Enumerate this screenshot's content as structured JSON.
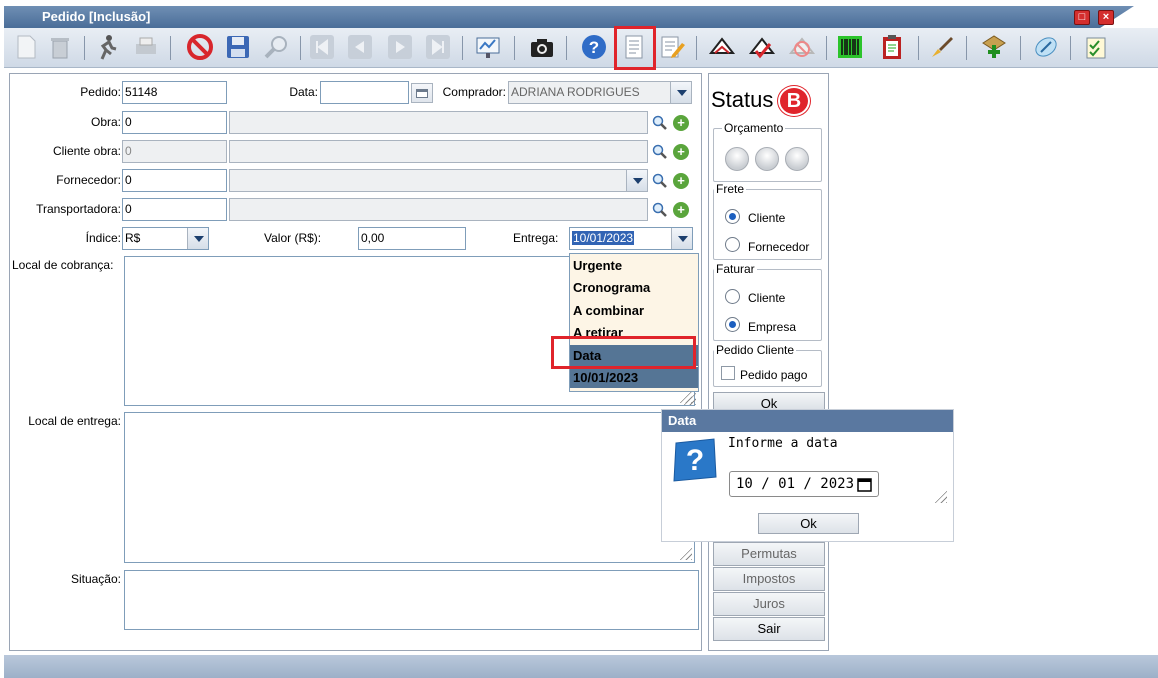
{
  "window": {
    "title": "Pedido [Inclusão]"
  },
  "toolbar": {
    "icons": [
      "new-icon",
      "trash-icon",
      "runner-icon",
      "print-icon",
      "stop-icon",
      "save-icon",
      "search-icon",
      "first-icon",
      "prev-icon",
      "next-icon",
      "last-icon",
      "report-icon",
      "camera-icon",
      "help-icon",
      "document-icon",
      "edit-icon",
      "hat-icon",
      "hat-check-icon",
      "hat-cancel-icon",
      "barcode-icon",
      "clipboard-icon",
      "brush-icon",
      "arrow-add-icon",
      "phone-icon",
      "checklist-icon"
    ]
  },
  "form": {
    "pedido_label": "Pedido:",
    "pedido_value": "51148",
    "data_label": "Data:",
    "data_value": "",
    "comprador_label": "Comprador:",
    "comprador_value": "ADRIANA RODRIGUES",
    "obra_label": "Obra:",
    "obra_value": "0",
    "cliente_obra_label": "Cliente obra:",
    "cliente_obra_value": "0",
    "fornecedor_label": "Fornecedor:",
    "fornecedor_value": "0",
    "transportadora_label": "Transportadora:",
    "transportadora_value": "0",
    "indice_label": "Índice:",
    "indice_value": "R$",
    "valor_label": "Valor (R$):",
    "valor_value": "0,00",
    "entrega_label": "Entrega:",
    "entrega_value": "10/01/2023",
    "local_cobranca_label": "Local de cobrança:",
    "local_entrega_label": "Local de entrega:",
    "situacao_label": "Situação:"
  },
  "entrega_dropdown": {
    "options": [
      "Urgente",
      "Cronograma",
      "A combinar",
      "A retirar",
      "Data",
      "10/01/2023"
    ],
    "selected": "Data"
  },
  "status": {
    "title": "Status",
    "badge": "B",
    "orcamento_label": "Orçamento",
    "frete_label": "Frete",
    "frete_options": [
      "Cliente",
      "Fornecedor"
    ],
    "frete_selected": "Cliente",
    "faturar_label": "Faturar",
    "faturar_options": [
      "Cliente",
      "Empresa"
    ],
    "faturar_selected": "Empresa",
    "pedido_cliente_label": "Pedido Cliente",
    "pedido_pago_label": "Pedido pago",
    "ok_label": "Ok",
    "buttons": [
      "Permutas",
      "Impostos",
      "Juros",
      "Sair"
    ]
  },
  "date_dialog": {
    "title": "Data",
    "prompt": "Informe a data",
    "value": "10 / 01 / 2023",
    "ok_label": "Ok"
  },
  "colors": {
    "titlebar": "#4a6d98",
    "selection": "#557595",
    "highlight_box": "#e0242b",
    "status_badge": "#e0242b"
  }
}
